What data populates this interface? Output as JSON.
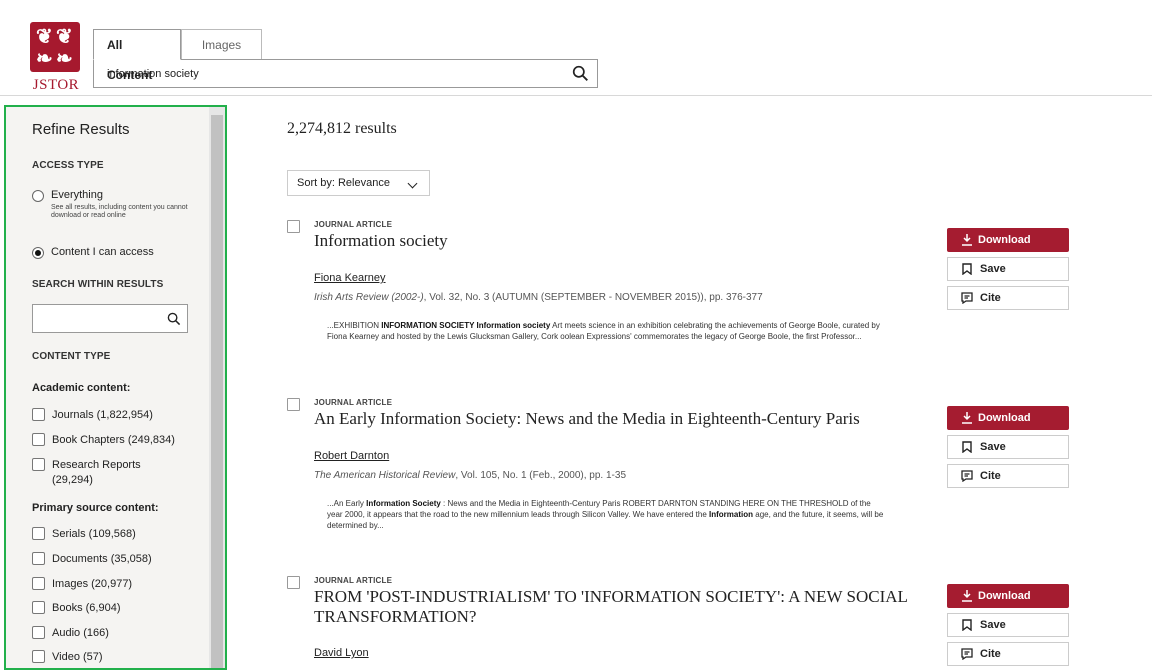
{
  "brand": {
    "logo_text": "JSTOR",
    "color": "#a6192e"
  },
  "header": {
    "tabs": [
      {
        "label": "All Content",
        "active": true
      },
      {
        "label": "Images",
        "active": false
      }
    ],
    "search": {
      "value": "information society",
      "icon": "search-icon"
    }
  },
  "sidebar": {
    "title": "Refine Results",
    "access_type": {
      "heading": "ACCESS TYPE",
      "options": [
        {
          "label": "Everything",
          "note": "See all results, including content you cannot download or read online",
          "selected": false
        },
        {
          "label": "Content I can access",
          "note": "",
          "selected": true
        }
      ]
    },
    "search_within": {
      "heading": "SEARCH WITHIN RESULTS",
      "value": "",
      "icon": "search-icon"
    },
    "content_type": {
      "heading": "CONTENT TYPE",
      "academic_heading": "Academic content:",
      "academic": [
        {
          "label": "Journals (1,822,954)"
        },
        {
          "label": "Book Chapters (249,834)"
        },
        {
          "label": "Research Reports",
          "label2": "(29,294)"
        }
      ],
      "primary_heading": "Primary source content:",
      "primary": [
        {
          "label": "Serials (109,568)"
        },
        {
          "label": "Documents (35,058)"
        },
        {
          "label": "Images (20,977)"
        },
        {
          "label": "Books (6,904)"
        },
        {
          "label": "Audio (166)"
        },
        {
          "label": "Video (57)"
        }
      ]
    }
  },
  "main": {
    "count": "2,274,812 results",
    "sort_label": "Sort by: Relevance",
    "buttons": {
      "download": "Download",
      "save": "Save",
      "cite": "Cite"
    },
    "results": [
      {
        "type": "JOURNAL ARTICLE",
        "title": "Information society",
        "author": "Fiona Kearney",
        "source_journal": "Irish Arts Review (2002-)",
        "source_rest": ", Vol. 32, No. 3 (AUTUMN (SEPTEMBER - NOVEMBER 2015)), pp. 376-377",
        "snippet_pre": "...EXHIBITION ",
        "snippet_bold": "INFORMATION SOCIETY Information society",
        "snippet_post": " Art meets science in an exhibition celebrating the achievements of George Boole, curated by Fiona Kearney and hosted by the Lewis Glucksman Gallery, Cork oolean Expressions' commemorates the legacy of George Boole, the first Professor..."
      },
      {
        "type": "JOURNAL ARTICLE",
        "title": "An Early Information Society: News and the Media in Eighteenth-Century Paris",
        "author": "Robert Darnton",
        "source_journal": "The American Historical Review",
        "source_rest": ", Vol. 105, No. 1 (Feb., 2000), pp. 1-35",
        "snippet_pre": "...An Early ",
        "snippet_bold": "Information Society",
        "snippet_mid": " : News and the Media in Eighteenth-Century Paris ROBERT DARNTON STANDING HERE ON THE THRESHOLD of the year 2000, it appears that the road to the new millennium leads through Silicon Valley. We have entered the ",
        "snippet_bold2": "Information",
        "snippet_post": " age, and the future, it seems, will be determined by..."
      },
      {
        "type": "JOURNAL ARTICLE",
        "title": "FROM 'POST-INDUSTRIALISM' TO 'INFORMATION SOCIETY': A NEW SOCIAL TRANSFORMATION?",
        "author": "David Lyon"
      }
    ]
  }
}
